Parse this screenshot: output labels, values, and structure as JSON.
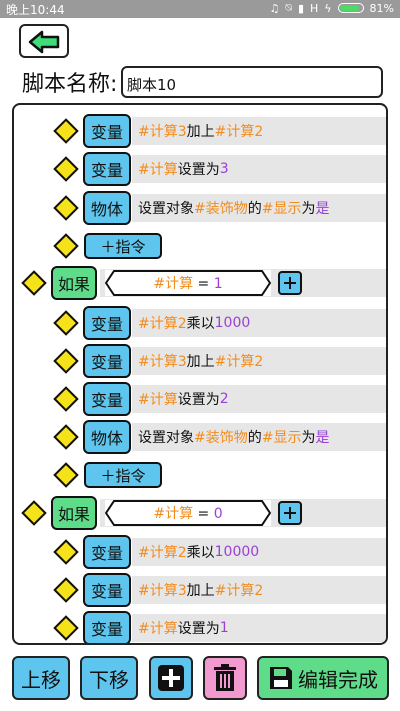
{
  "status": {
    "time": "晚上10:44",
    "signal": "H",
    "battery": "81%",
    "battery_level": 0.81
  },
  "header": {
    "name_label": "脚本名称:",
    "name_value": "脚本10"
  },
  "rows": [
    {
      "tag": "变量",
      "parts": [
        {
          "t": "#计算3",
          "c": "v"
        },
        {
          "t": " 加上 ",
          "c": "k"
        },
        {
          "t": "#计算2",
          "c": "v"
        }
      ]
    },
    {
      "tag": "变量",
      "parts": [
        {
          "t": "#计算",
          "c": "v"
        },
        {
          "t": " 设置为 ",
          "c": "k"
        },
        {
          "t": "3",
          "c": "n"
        }
      ]
    },
    {
      "tag": "物体",
      "parts": [
        {
          "t": "设置对象",
          "c": "k"
        },
        {
          "t": "#装饰物",
          "c": "v"
        },
        {
          "t": "的",
          "c": "k"
        },
        {
          "t": "#显示",
          "c": "v"
        },
        {
          "t": "为",
          "c": "k"
        },
        {
          "t": "是",
          "c": "n"
        }
      ]
    },
    {
      "add": "指令"
    },
    {
      "if": "如果",
      "cond": [
        {
          "t": "#计算",
          "c": "v"
        },
        {
          "t": " = ",
          "c": "k"
        },
        {
          "t": "1",
          "c": "n"
        }
      ]
    },
    {
      "tag": "变量",
      "parts": [
        {
          "t": "#计算2",
          "c": "v"
        },
        {
          "t": " 乘以 ",
          "c": "k"
        },
        {
          "t": "1000",
          "c": "n"
        }
      ]
    },
    {
      "tag": "变量",
      "parts": [
        {
          "t": "#计算3",
          "c": "v"
        },
        {
          "t": " 加上 ",
          "c": "k"
        },
        {
          "t": "#计算2",
          "c": "v"
        }
      ]
    },
    {
      "tag": "变量",
      "parts": [
        {
          "t": "#计算",
          "c": "v"
        },
        {
          "t": " 设置为 ",
          "c": "k"
        },
        {
          "t": "2",
          "c": "n"
        }
      ]
    },
    {
      "tag": "物体",
      "parts": [
        {
          "t": "设置对象",
          "c": "k"
        },
        {
          "t": "#装饰物",
          "c": "v"
        },
        {
          "t": "的",
          "c": "k"
        },
        {
          "t": "#显示",
          "c": "v"
        },
        {
          "t": "为",
          "c": "k"
        },
        {
          "t": "是",
          "c": "n"
        }
      ]
    },
    {
      "add": "指令"
    },
    {
      "if": "如果",
      "cond": [
        {
          "t": "#计算",
          "c": "v"
        },
        {
          "t": " = ",
          "c": "k"
        },
        {
          "t": "0",
          "c": "n"
        }
      ]
    },
    {
      "tag": "变量",
      "parts": [
        {
          "t": "#计算2",
          "c": "v"
        },
        {
          "t": " 乘以 ",
          "c": "k"
        },
        {
          "t": "10000",
          "c": "n"
        }
      ]
    },
    {
      "tag": "变量",
      "parts": [
        {
          "t": "#计算3",
          "c": "v"
        },
        {
          "t": " 加上 ",
          "c": "k"
        },
        {
          "t": "#计算2",
          "c": "v"
        }
      ]
    },
    {
      "tag": "变量",
      "parts": [
        {
          "t": "#计算",
          "c": "v"
        },
        {
          "t": " 设置为 ",
          "c": "k"
        },
        {
          "t": "1",
          "c": "n"
        }
      ]
    }
  ],
  "toolbar": {
    "move_up": "上移",
    "move_down": "下移",
    "done": "编辑完成"
  },
  "icons": {
    "back": "back-arrow-icon",
    "add": "plus-icon",
    "delete": "trash-icon",
    "save": "floppy-disk-icon"
  },
  "colors": {
    "blue": "#5ec6ee",
    "green": "#5fdc8a",
    "yellow": "#f6e21a",
    "pink": "#f29ad0",
    "orange": "#f28c1e",
    "purple": "#9b3fd6",
    "back_arrow": "#3fdc7a"
  }
}
